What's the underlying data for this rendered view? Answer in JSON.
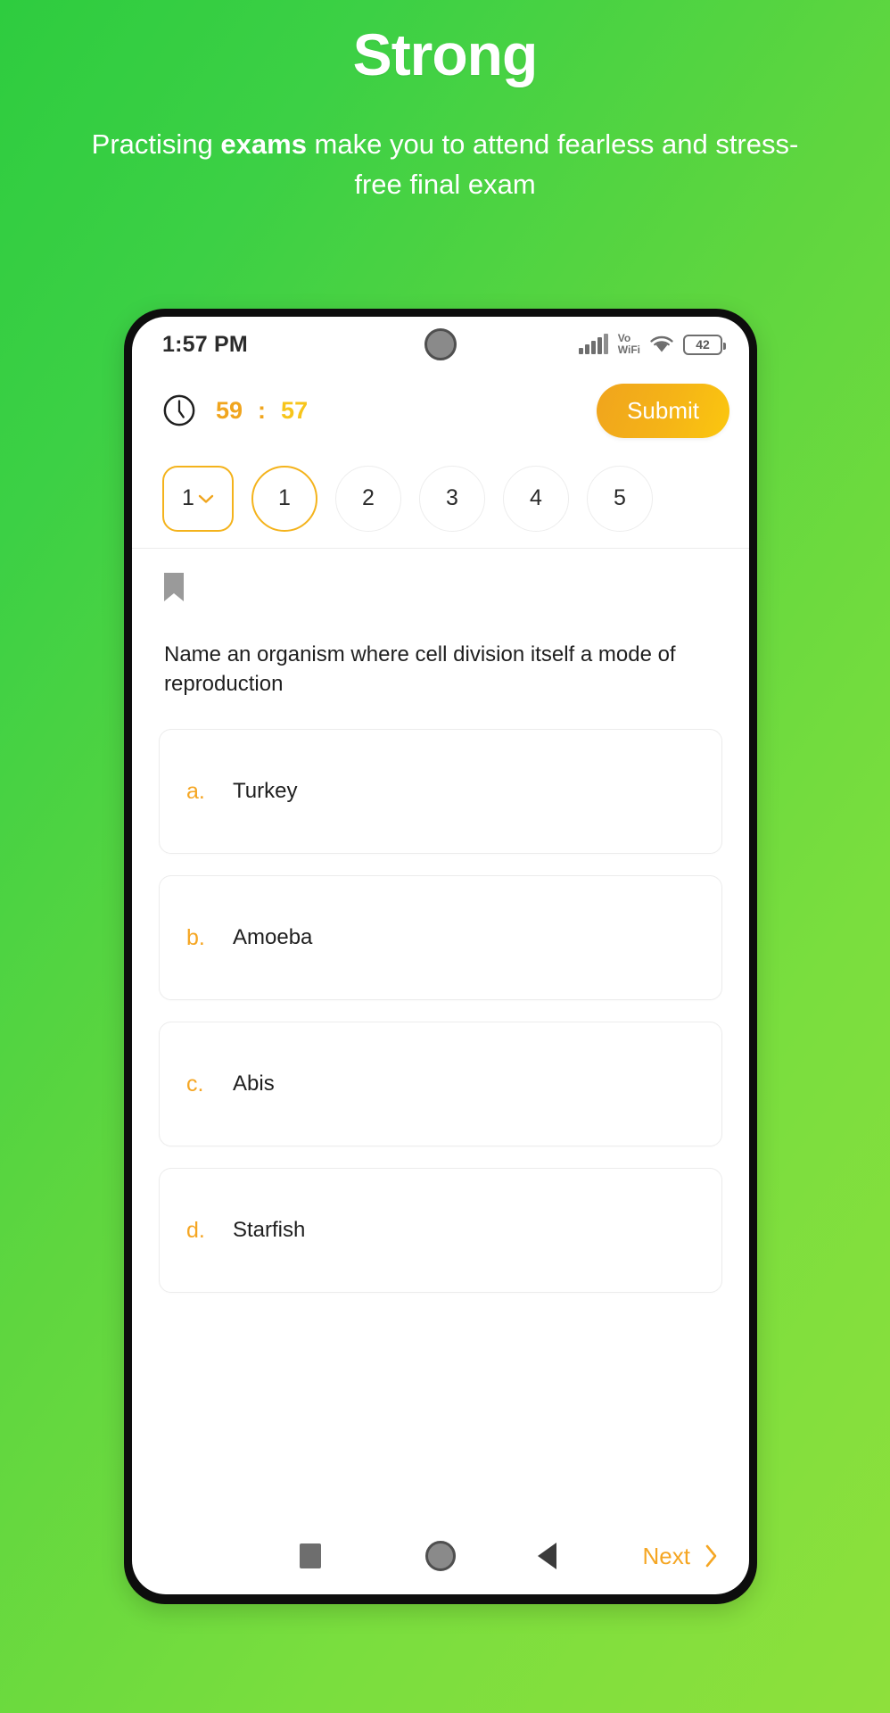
{
  "promo": {
    "title": "Strong",
    "subtitle_before": "Practising ",
    "subtitle_bold": "exams",
    "subtitle_after": " make you to attend fearless and stress-free final exam"
  },
  "theme": {
    "bg_green_start": "#2ecc3f",
    "bg_green_end": "#8ee03c",
    "accent_amber": "#f5a623",
    "accent_yellow": "#f7c51b",
    "card_border": "#ececec"
  },
  "statusbar": {
    "time": "1:57 PM",
    "signal_icon": "signal-bars-icon",
    "vowifi_line1": "Vo",
    "vowifi_line2": "WiFi",
    "wifi_icon": "wifi-icon",
    "battery_level": "42",
    "camera_icon": "front-camera-icon"
  },
  "timer": {
    "clock_icon": "clock-icon",
    "minutes": "59",
    "separator": ":",
    "seconds": "57"
  },
  "toolbar": {
    "submit_label": "Submit"
  },
  "question_nav": {
    "selector_value": "1",
    "chevron_icon": "chevron-down-icon",
    "pills": [
      {
        "label": "1",
        "active": true
      },
      {
        "label": "2",
        "active": false
      },
      {
        "label": "3",
        "active": false
      },
      {
        "label": "4",
        "active": false
      },
      {
        "label": "5",
        "active": false
      }
    ]
  },
  "question": {
    "bookmark_icon": "bookmark-icon",
    "text": "Name an organism where cell division itself a mode of reproduction",
    "options": [
      {
        "letter": "a.",
        "text": "Turkey"
      },
      {
        "letter": "b.",
        "text": "Amoeba"
      },
      {
        "letter": "c.",
        "text": "Abis"
      },
      {
        "letter": "d.",
        "text": "Starfish"
      }
    ]
  },
  "navbar": {
    "recents_icon": "recents-square-icon",
    "home_icon": "home-circle-icon",
    "back_icon": "back-triangle-icon",
    "next_label": "Next",
    "next_icon": "chevron-right-icon"
  }
}
